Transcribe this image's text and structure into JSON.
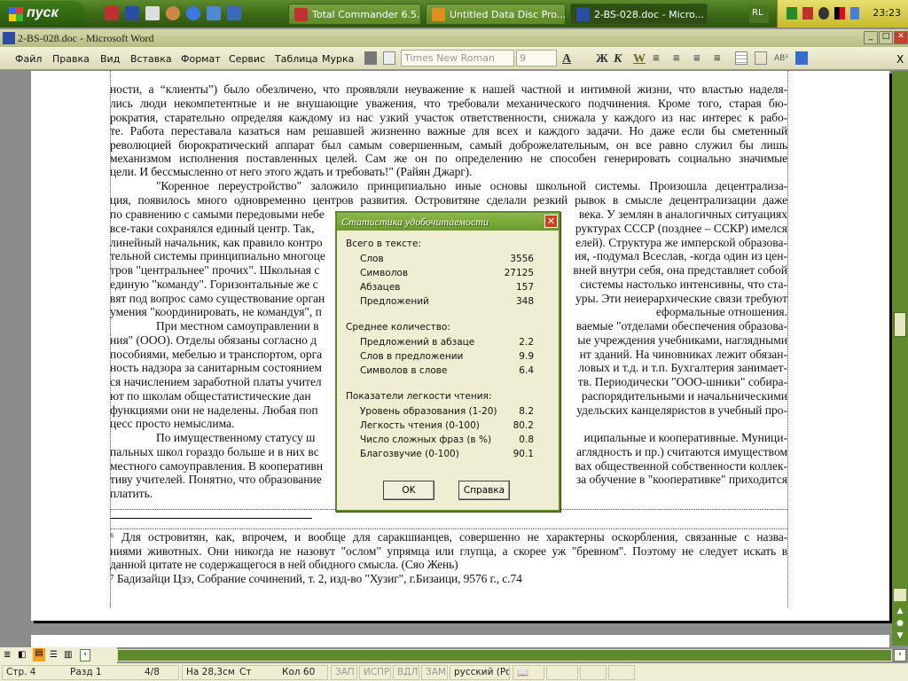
{
  "taskbar": {
    "start_label": "пуск",
    "tasks": [
      "Total Commander 6.5...",
      "Untitled Data Disc Pro...",
      "2-BS-028.doc - Micro..."
    ],
    "lang": "RL",
    "clock": "23:23"
  },
  "window": {
    "title": "2-BS-028.doc - Microsoft Word"
  },
  "menu": {
    "items": [
      "Файл",
      "Правка",
      "Вид",
      "Вставка",
      "Формат",
      "Сервис",
      "Таблица",
      "Мурка"
    ],
    "font_name": "Times New Roman",
    "font_size": "9",
    "bold": "Ж",
    "italic": "К",
    "underline": "W",
    "superscript": "AB¹",
    "close": "X"
  },
  "document": {
    "full_lines": [
      "ности, а “клиенты”) было обезличено, что проявляли неуважение к нашей частной и интимной жизни, что властью наделя-",
      "лись люди некомпетентные и не внушающие уважения, что требовали механического подчинения. Кроме того, старая бю-",
      "рократия, старательно определяя каждому из нас узкий участок ответственности, снижала у каждого из нас  интерес к рабо-",
      "те. Работа переставала казаться нам решавшей жизненно важные для всех и каждого задачи. Но даже если бы сметенный",
      "революцией бюрократический аппарат был самым совершенным, самый доброжелательным, он все равно служил бы лишь",
      "механизмом исполнения поставленных целей. Сам же он по определению не способен генерировать социально значимые",
      "цели. И бессмысленно от него этого ждать и требовать!\" (Райян Джарг).",
      "\"Коренное переустройство\" заложило принципиально иные основы школьной системы. Произошла децентрализа-",
      "ция, появилось много одновременно центров развития. Островитяне сделали резкий рывок в смысле децентрализации даже"
    ],
    "split_lines": [
      {
        "left": "по сравнению с самыми передовыми небе",
        "right": "века. У землян в аналогичных ситуациях"
      },
      {
        "left": "все-таки сохранялся единый центр. Так,",
        "right": "руктурах СССР (позднее – ССКР) имелся"
      },
      {
        "left": "линейный начальник, как правило контро",
        "right": "елей). Структура же имперской образова-"
      },
      {
        "left": "тельной системы принципиально многоце",
        "right": "ия, -подумал Всеслав, -когда один из цен-"
      },
      {
        "left": "тров \"центральнее\" прочих\". Школьная с",
        "right": "вней внутри себя, она представляет собой"
      },
      {
        "left": "единую \"команду\". Горизонтальные же с",
        "right": "системы настолько интенсивны, что ста-"
      },
      {
        "left": "вят под вопрос само существование орган",
        "right": "уры. Эти неиерархические связи требуют"
      },
      {
        "left": "умения \"координировать, не командуя\", п",
        "right": "еформальные отношения."
      },
      {
        "left": "При местном самоуправлении в",
        "right": "ваемые \"отделами обеспечения образова-"
      },
      {
        "left": "ния\" (ООО). Отделы обязаны согласно д",
        "right": "ые учреждения учебниками, наглядными"
      },
      {
        "left": "пособиями, мебелью и транспортом, орга",
        "right": "нт зданий. На чиновниках лежит обязан-"
      },
      {
        "left": "ность надзора за санитарным состоянием",
        "right": "ловых и т.д. и т.п. Бухгалтерия занимает-"
      },
      {
        "left": "ся начислением заработной платы учител",
        "right": "тв. Периодически \"ООО-шники\" собира-"
      },
      {
        "left": "ют по школам общестатистические дан",
        "right": "распорядительными и начальническими"
      },
      {
        "left": "функциями они не наделены. Любая поп",
        "right": "удельских канцеляристов в учебный про-"
      },
      {
        "left": "цесс просто немыслима.",
        "right": ""
      },
      {
        "left": "По имущественному статусу ш",
        "right": "иципальные и кооперативные. Муници-"
      },
      {
        "left": "пальных школ гораздо больше и в них вс",
        "right": "аглядность и пр.) считаются имуществом"
      },
      {
        "left": "местного самоуправления. В кооперативн",
        "right": "вах общественной собственности коллек-"
      },
      {
        "left": "тиву учителей. Понятно, что образование",
        "right": "за обучение в \"кооперативке\" приходится"
      },
      {
        "left": "платить.",
        "right": ""
      }
    ],
    "footnotes": [
      "⁶ Для островитян, как, впрочем, и вообще для саракшианцев, совершенно не характерны оскорбления, связанные с назва-",
      "ниями животных. Они никогда не назовут \"ослом\" упрямца или глупца, а скорее уж \"бревном\". Поэтому не следует искать в",
      "данной цитате не содержащегося в ней обидного смысла. (Сяо Жень)",
      "⁷ Бадизайци Цзэ, Собрание сочинений, т. 2, изд-во \"Хузиг\", г.Бизаици, 9576 г., с.74"
    ]
  },
  "dialog": {
    "title": "Статистика удобочитаемости",
    "sections": [
      {
        "heading": "Всего в тексте:",
        "rows": [
          {
            "label": "Слов",
            "value": "3556"
          },
          {
            "label": "Символов",
            "value": "27125"
          },
          {
            "label": "Абзацев",
            "value": "157"
          },
          {
            "label": "Предложений",
            "value": "348"
          }
        ]
      },
      {
        "heading": "Среднее количество:",
        "rows": [
          {
            "label": "Предложений в абзаце",
            "value": "2.2"
          },
          {
            "label": "Слов в предложении",
            "value": "9.9"
          },
          {
            "label": "Символов в слове",
            "value": "6.4"
          }
        ]
      },
      {
        "heading": "Показатели легкости чтения:",
        "rows": [
          {
            "label": "Уровень образования (1-20)",
            "value": "8.2"
          },
          {
            "label": "Легкость чтения (0-100)",
            "value": "80.2"
          },
          {
            "label": "Число сложных фраз (в %)",
            "value": "0.8"
          },
          {
            "label": "Благозвучие (0-100)",
            "value": "90.1"
          }
        ]
      }
    ],
    "ok": "OK",
    "help": "Справка"
  },
  "status": {
    "page": "Стр. 4",
    "section": "Разд 1",
    "pages": "4/8",
    "at": "На 28,3см",
    "line": "Ст",
    "col": "Кол 60",
    "rec": "ЗАП",
    "trk": "ИСПР",
    "ext": "ВДЛ",
    "ovr": "ЗАМ",
    "lang": "русский (Ро"
  },
  "colors": {
    "taskbar": "#3e6b17",
    "dialog_title": "#6a9a2e",
    "dialog_bg": "#efedd2",
    "close": "#d43c20"
  }
}
